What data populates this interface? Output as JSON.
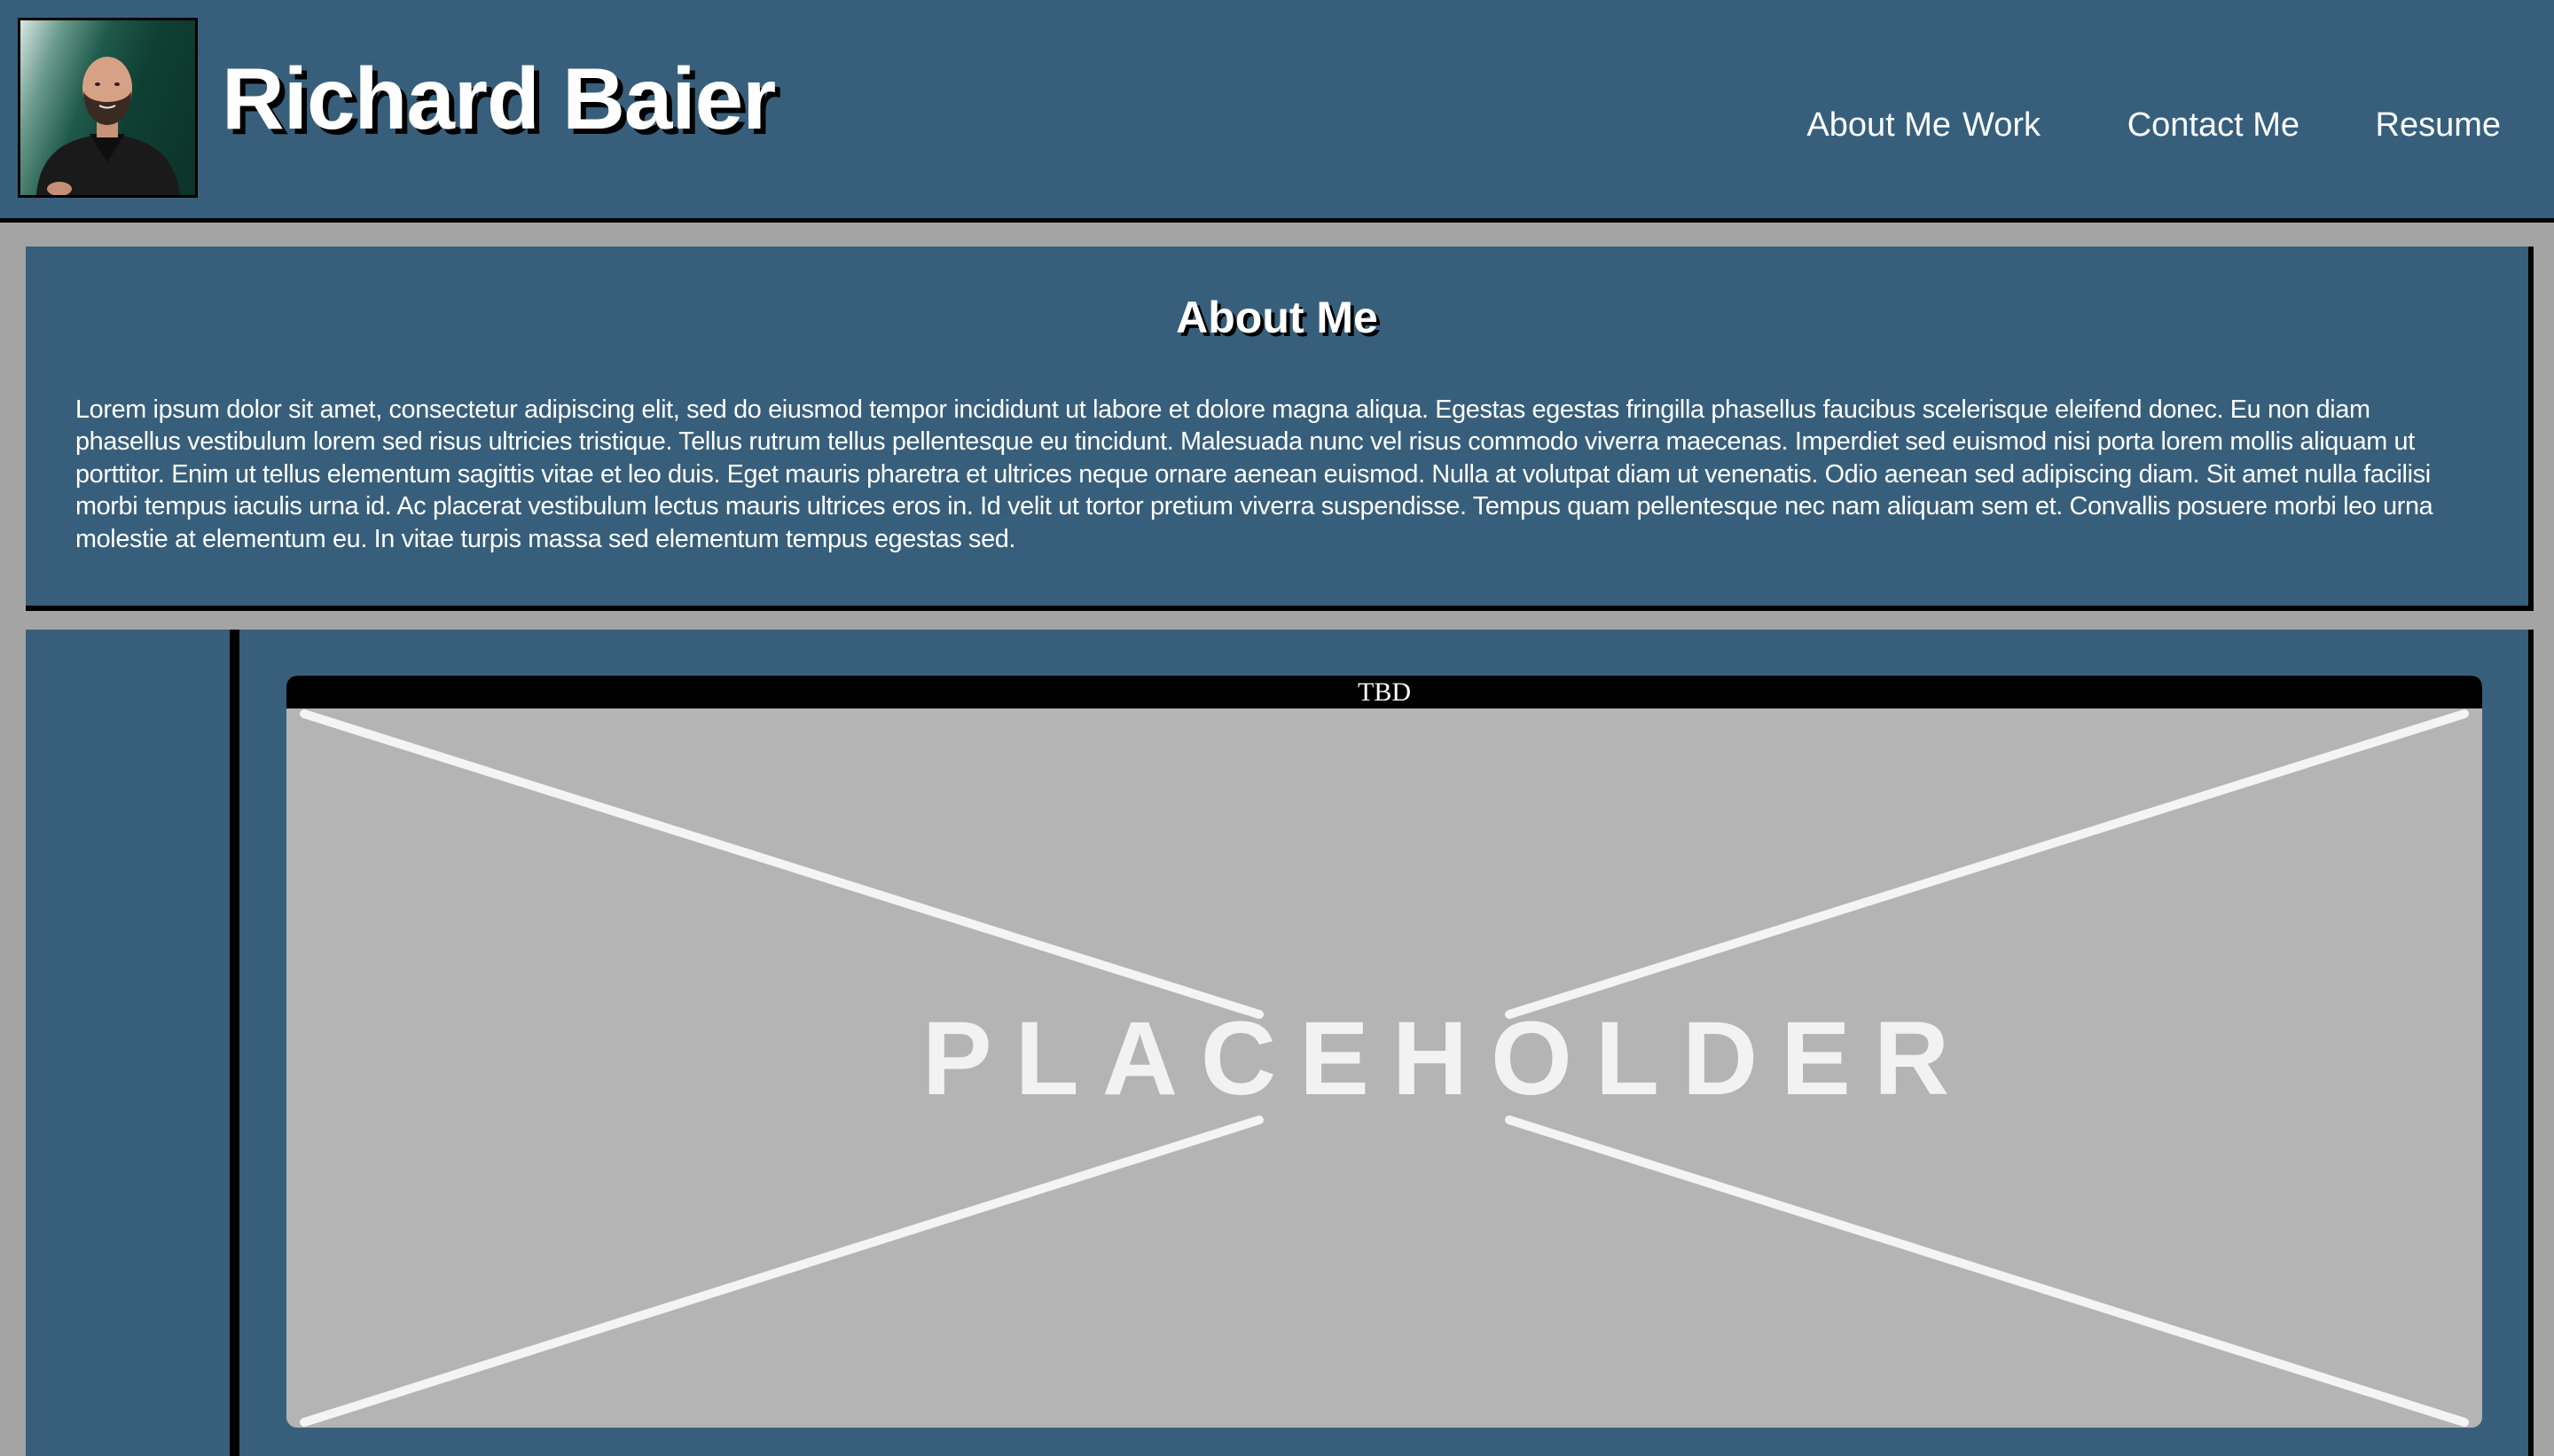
{
  "header": {
    "name": "Richard Baier",
    "avatar_icon": "profile-photo",
    "nav": [
      {
        "label": "About Me"
      },
      {
        "label": "Work"
      },
      {
        "label": "Contact Me"
      },
      {
        "label": "Resume"
      }
    ]
  },
  "about": {
    "heading": "About Me",
    "body": "Lorem ipsum dolor sit amet, consectetur adipiscing elit, sed do eiusmod tempor incididunt ut labore et dolore magna aliqua. Egestas egestas fringilla phasellus faucibus scelerisque eleifend donec. Eu non diam phasellus vestibulum lorem sed risus ultricies tristique. Tellus rutrum tellus pellentesque eu tincidunt. Malesuada nunc vel risus commodo viverra maecenas. Imperdiet sed euismod nisi porta lorem mollis aliquam ut porttitor. Enim ut tellus elementum sagittis vitae et leo duis. Eget mauris pharetra et ultrices neque ornare aenean euismod. Nulla at volutpat diam ut venenatis. Odio aenean sed adipiscing diam. Sit amet nulla facilisi morbi tempus iaculis urna id. Ac placerat vestibulum lectus mauris ultrices eros in. Id velit ut tortor pretium viverra suspendisse. Tempus quam pellentesque nec nam aliquam sem et. Convallis posuere morbi leo urna molestie at elementum eu. In vitae turpis massa sed elementum tempus egestas sed."
  },
  "work": {
    "project": {
      "title": "TBD",
      "image_text": "PLACEHOLDER"
    }
  },
  "colors": {
    "panel": "#375f7b",
    "page_background": "#a4a4a4",
    "border": "#000000",
    "text": "#ffffff",
    "placeholder_background": "#b4b4b4"
  }
}
